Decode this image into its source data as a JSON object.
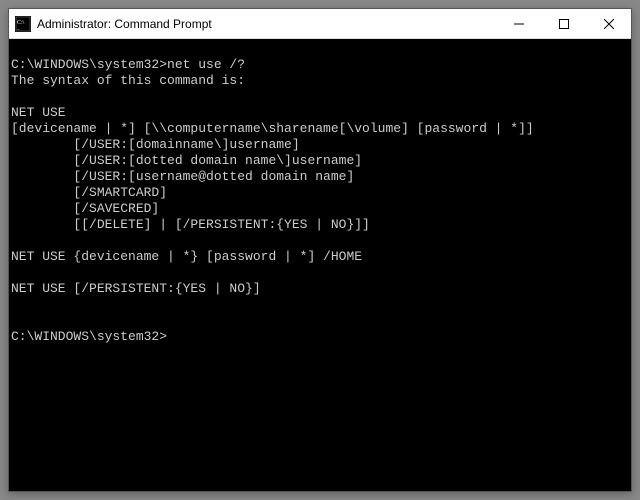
{
  "window": {
    "title": "Administrator: Command Prompt"
  },
  "terminal": {
    "lines": [
      "",
      "C:\\WINDOWS\\system32>net use /?",
      "The syntax of this command is:",
      "",
      "NET USE",
      "[devicename | *] [\\\\computername\\sharename[\\volume] [password | *]]",
      "        [/USER:[domainname\\]username]",
      "        [/USER:[dotted domain name\\]username]",
      "        [/USER:[username@dotted domain name]",
      "        [/SMARTCARD]",
      "        [/SAVECRED]",
      "        [[/DELETE] | [/PERSISTENT:{YES | NO}]]",
      "",
      "NET USE {devicename | *} [password | *] /HOME",
      "",
      "NET USE [/PERSISTENT:{YES | NO}]",
      "",
      "",
      "C:\\WINDOWS\\system32>"
    ]
  }
}
